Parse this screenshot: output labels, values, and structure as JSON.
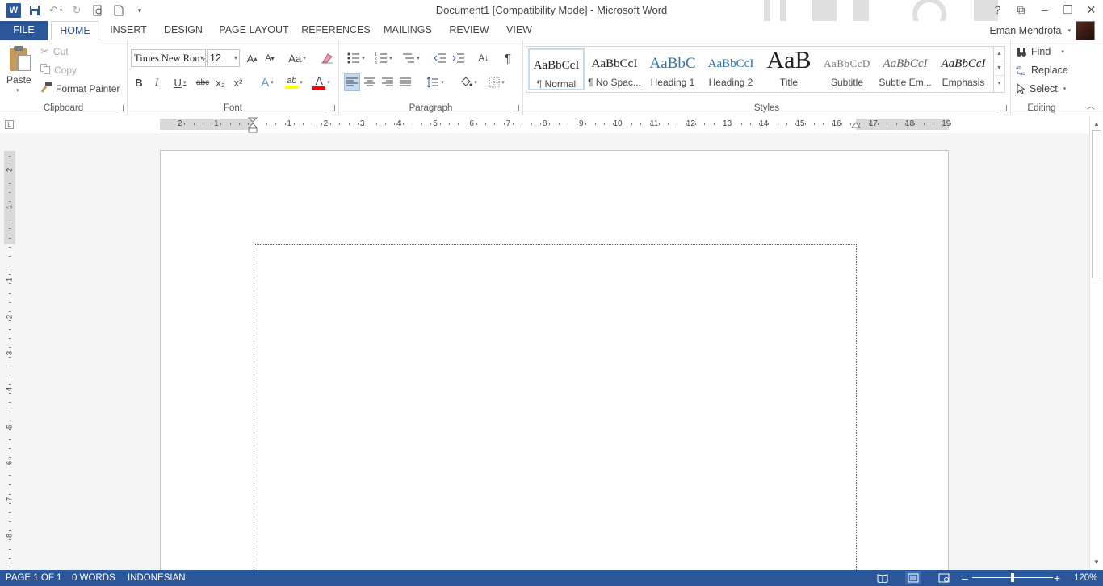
{
  "window": {
    "title": "Document1 [Compatibility Mode] - Microsoft Word",
    "controls": [
      "?",
      "⧉",
      "–",
      "❐",
      "✕"
    ]
  },
  "qat": {
    "logo": "W",
    "undo_icon": "↶",
    "redo_icon": "↻",
    "dd": "▾"
  },
  "tabs": {
    "file": "FILE",
    "items": [
      "HOME",
      "INSERT",
      "DESIGN",
      "PAGE LAYOUT",
      "REFERENCES",
      "MAILINGS",
      "REVIEW",
      "VIEW"
    ],
    "active": "HOME"
  },
  "user": {
    "name": "Eman Mendrofa",
    "dd": "▾"
  },
  "clipboard": {
    "paste": "Paste",
    "cut": "Cut",
    "copy": "Copy",
    "format_painter": "Format Painter",
    "label": "Clipboard",
    "paste_dd": "▾"
  },
  "font": {
    "name": "Times New Roman",
    "size": "12",
    "label": "Font",
    "grow": "A",
    "shrink": "A",
    "case": "Aa",
    "bold": "B",
    "italic": "I",
    "underline": "U",
    "strike": "abc",
    "sub": "x₂",
    "sup": "x²",
    "effects": "A",
    "highlight": "ab",
    "color": "A",
    "dd": "▾"
  },
  "paragraph": {
    "label": "Paragraph",
    "pilcrow": "¶",
    "sort": "A↓"
  },
  "styles": {
    "label": "Styles",
    "items": [
      {
        "sample": "AaBbCcI",
        "name": "¶ Normal"
      },
      {
        "sample": "AaBbCcI",
        "name": "¶ No Spac..."
      },
      {
        "sample": "AaBbC",
        "name": "Heading 1"
      },
      {
        "sample": "AaBbCcI",
        "name": "Heading 2"
      },
      {
        "sample": "AaB",
        "name": "Title"
      },
      {
        "sample": "AaBbCcD",
        "name": "Subtitle"
      },
      {
        "sample": "AaBbCcI",
        "name": "Subtle Em..."
      },
      {
        "sample": "AaBbCcI",
        "name": "Emphasis"
      }
    ],
    "selected": 0
  },
  "editing": {
    "label": "Editing",
    "find": "Find",
    "replace": "Replace",
    "select": "Select",
    "replace_icon": "ab→ac",
    "dd": "▾"
  },
  "ruler": {
    "corner": "L",
    "h_numbers": [
      "2",
      "1",
      "1",
      "2",
      "3",
      "4",
      "5",
      "6",
      "7",
      "8",
      "9",
      "10",
      "11",
      "12",
      "13",
      "14",
      "15",
      "16",
      "17",
      "18",
      "19"
    ],
    "v_numbers": [
      "2",
      "1",
      "1",
      "2",
      "3",
      "4",
      "5",
      "6",
      "7",
      "8"
    ]
  },
  "status": {
    "page": "PAGE 1 OF 1",
    "words": "0 WORDS",
    "language": "INDONESIAN",
    "zoom": "120%",
    "zoom_minus": "–",
    "zoom_plus": "+",
    "zoom_level": 0.5
  },
  "colors": {
    "accent": "#2b579a",
    "highlight": "#ffff00",
    "font_color": "#ff0000"
  }
}
